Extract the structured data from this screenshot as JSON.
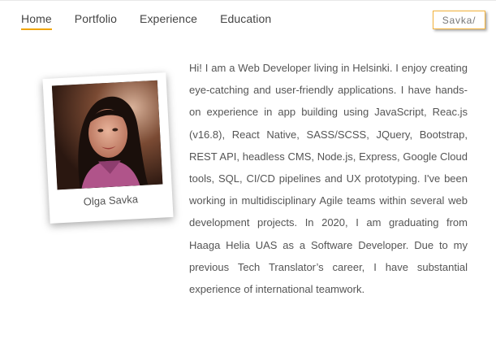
{
  "nav": {
    "items": [
      {
        "label": "Home",
        "active": true
      },
      {
        "label": "Portfolio",
        "active": false
      },
      {
        "label": "Experience",
        "active": false
      },
      {
        "label": "Education",
        "active": false
      }
    ]
  },
  "logo": {
    "text": "Savka/"
  },
  "profile": {
    "name": "Olga Savka"
  },
  "bio": {
    "text": "Hi! I am a Web Developer living in Helsinki. I enjoy creating eye-catching and user-friendly applications. I have hands-on experience in app building using JavaScript, Reac.js (v16.8), React Native, SASS/SCSS, JQuery, Bootstrap, REST API, headless CMS, Node.js, Express, Google Cloud tools, SQL, CI/CD pipelines and UX prototyping. I've been working in multidisciplinary Agile teams within several web development projects. In 2020, I am graduating from Haaga Helia UAS as a Software Developer. Due to my previous Tech Translator’s career, I have substantial experience of international teamwork."
  },
  "colors": {
    "accent": "#f0a500"
  }
}
